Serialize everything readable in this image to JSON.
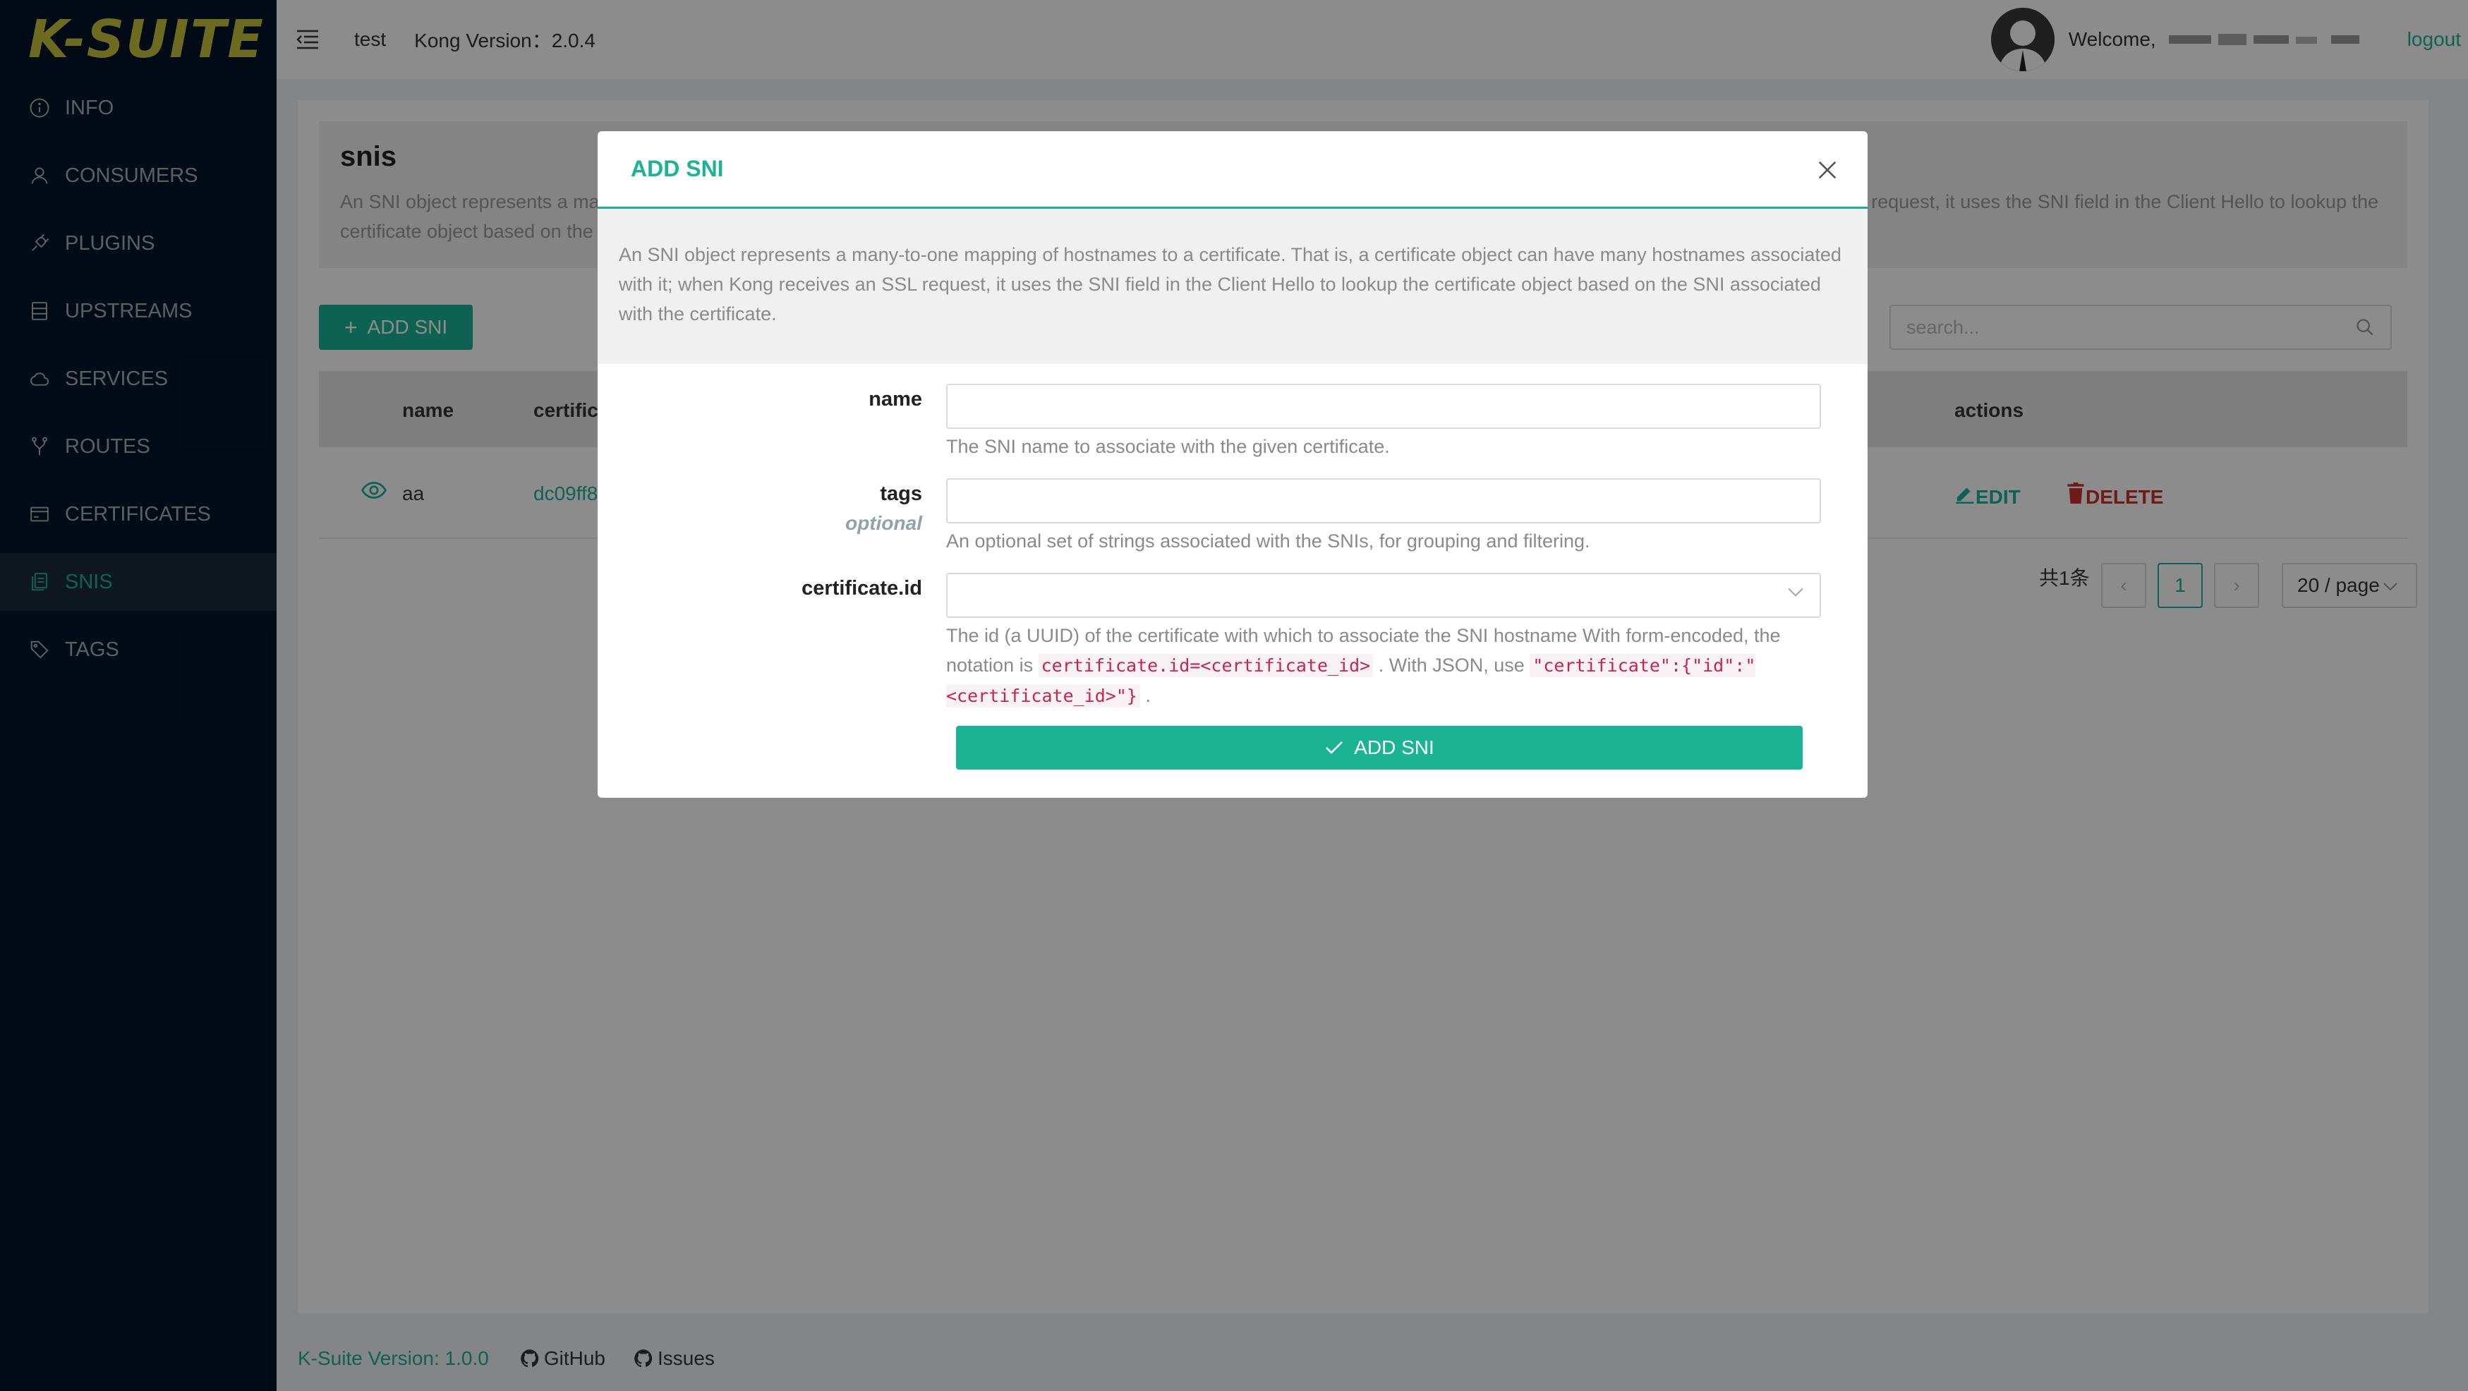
{
  "app": {
    "logo": "K-SUITE"
  },
  "sidebar": {
    "items": [
      {
        "label": "INFO",
        "icon": "info-icon"
      },
      {
        "label": "CONSUMERS",
        "icon": "user-icon"
      },
      {
        "label": "PLUGINS",
        "icon": "plug-icon"
      },
      {
        "label": "UPSTREAMS",
        "icon": "database-icon"
      },
      {
        "label": "SERVICES",
        "icon": "cloud-icon"
      },
      {
        "label": "ROUTES",
        "icon": "fork-icon"
      },
      {
        "label": "CERTIFICATES",
        "icon": "card-icon"
      },
      {
        "label": "SNIS",
        "icon": "snippets-icon",
        "active": true
      },
      {
        "label": "TAGS",
        "icon": "tag-icon"
      }
    ]
  },
  "header": {
    "workspace": "test",
    "kong_version": "Kong Version：2.0.4",
    "welcome": "Welcome,",
    "logout": "logout"
  },
  "page": {
    "title": "snis",
    "description": "An SNI object represents a many-to-one mapping of hostnames to a certificate. That is, a certificate object can have many hostnames associated with it; when Kong receives an SSL request, it uses the SNI field in the Client Hello to lookup the certificate object based on the SNI associated with the certificate.",
    "add_button": "ADD SNI",
    "search_placeholder": "search..."
  },
  "table": {
    "columns": [
      "name",
      "certificate",
      "actions"
    ],
    "rows": [
      {
        "name": "aa",
        "certificate": "dc09ff8",
        "edit": "EDIT",
        "delete": "DELETE"
      }
    ]
  },
  "pagination": {
    "total": "共1条",
    "current": "1",
    "page_size": "20 / page"
  },
  "footer": {
    "version": "K-Suite Version: 1.0.0",
    "github": "GitHub",
    "issues": "Issues"
  },
  "modal": {
    "title": "ADD SNI",
    "description": "An SNI object represents a many-to-one mapping of hostnames to a certificate. That is, a certificate object can have many hostnames associated with it; when Kong receives an SSL request, it uses the SNI field in the Client Hello to lookup the certificate object based on the SNI associated with the certificate.",
    "fields": {
      "name": {
        "label": "name",
        "value": "",
        "help": "The SNI name to associate with the given certificate."
      },
      "tags": {
        "label": "tags",
        "optional": "optional",
        "value": "",
        "help": "An optional set of strings associated with the SNIs, for grouping and filtering."
      },
      "certificate": {
        "label": "certificate.id",
        "value": "",
        "help_1": "The id (a UUID) of the certificate with which to associate the SNI hostname With form-encoded, the notation is",
        "code_1": "certificate.id=<certificate_id>",
        "help_2": ". With JSON, use",
        "code_2": "\"certificate\":{\"id\":\"<certificate_id>\"}",
        "help_3": "."
      }
    },
    "submit": "ADD SNI"
  },
  "colors": {
    "accent": "#1ab394",
    "sidebar_bg": "#001529",
    "danger": "#c9302c"
  }
}
